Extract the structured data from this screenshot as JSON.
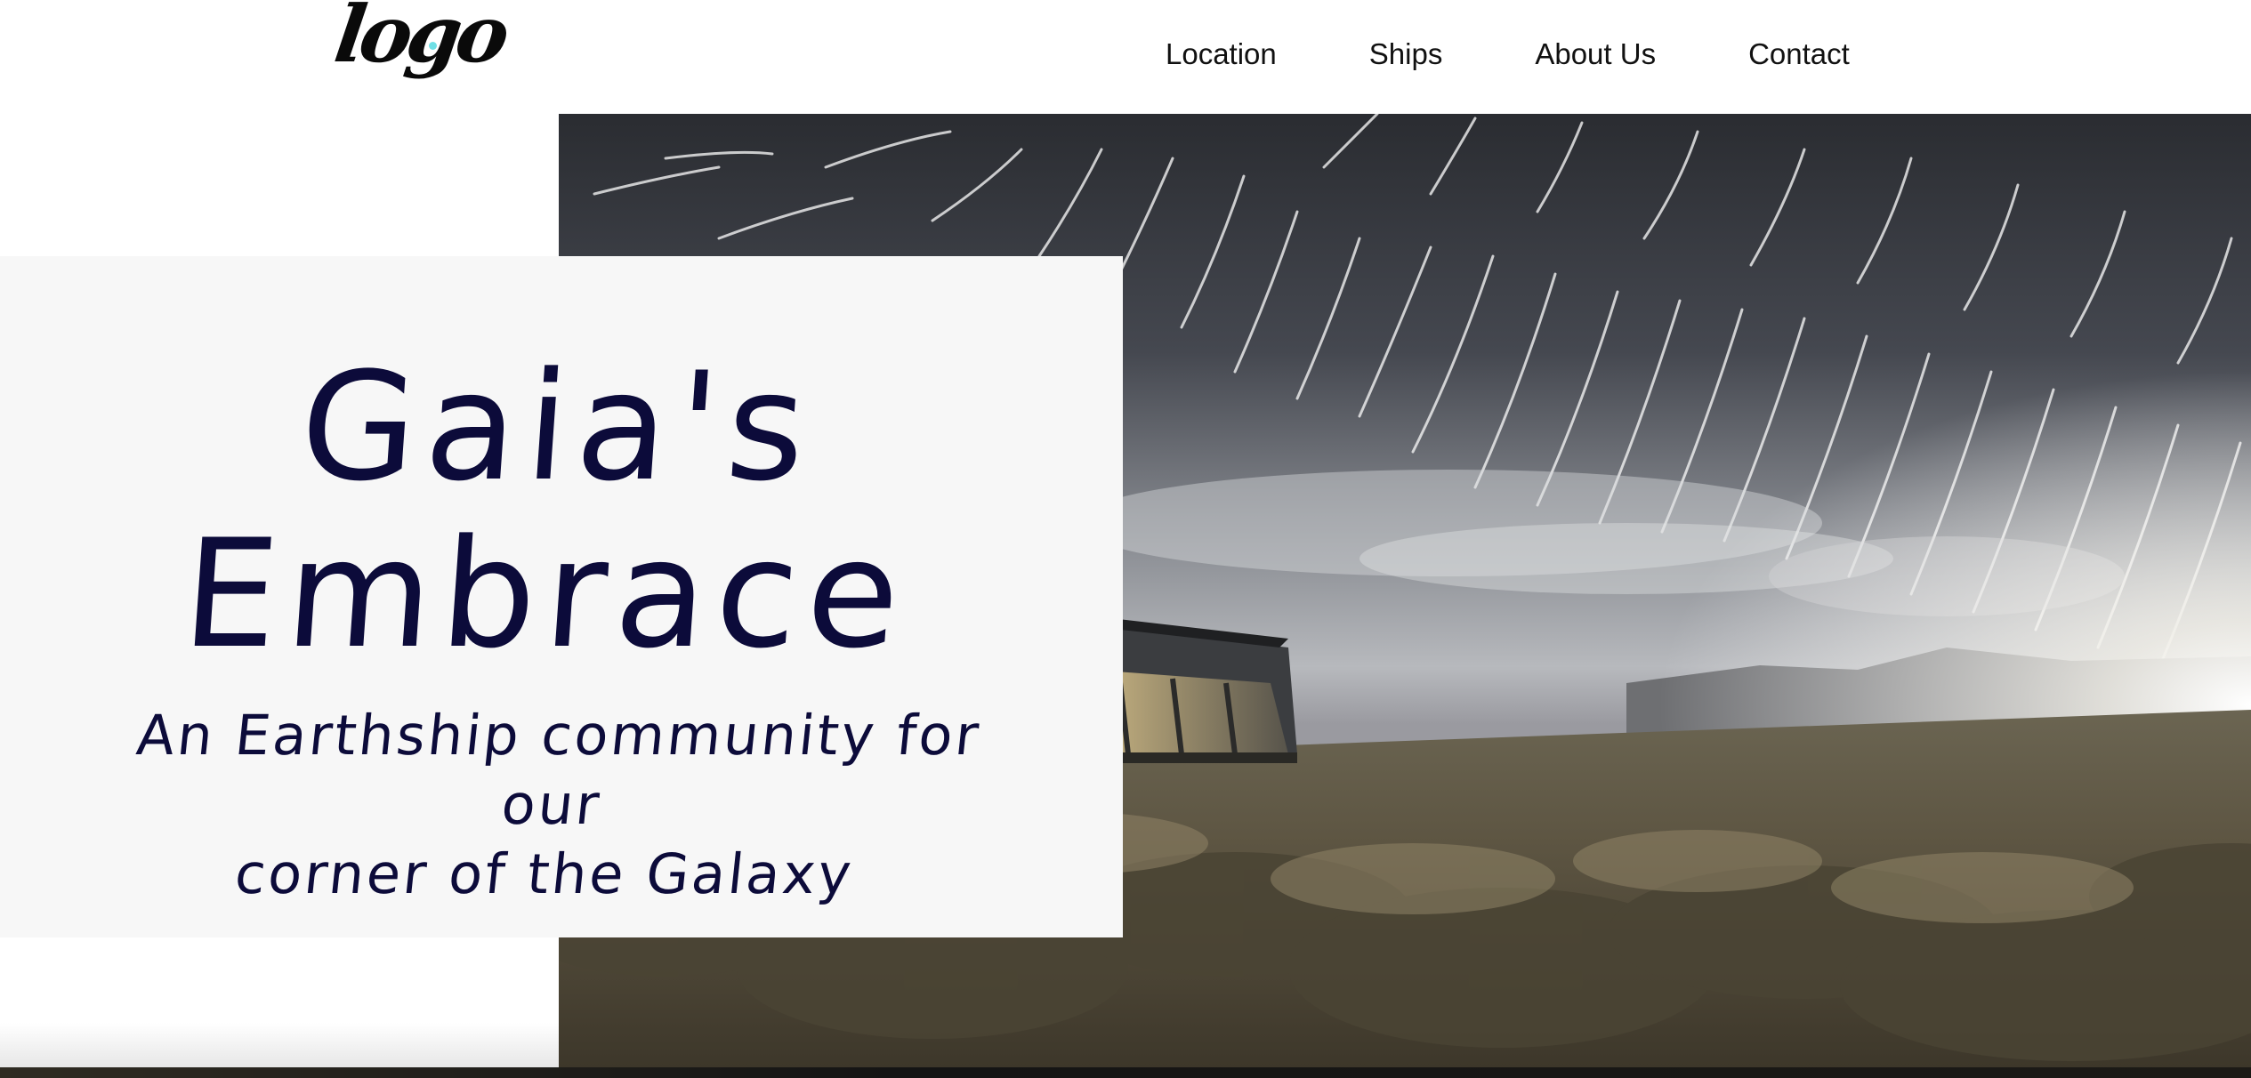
{
  "header": {
    "logo_text": "logo",
    "nav": [
      {
        "label": "Location"
      },
      {
        "label": "Ships"
      },
      {
        "label": "About Us"
      },
      {
        "label": "Contact"
      }
    ]
  },
  "hero": {
    "title_line1": "Gaia's",
    "title_line2": "Embrace",
    "subtitle_line1": "An Earthship community for our",
    "subtitle_line2": "corner of the Galaxy"
  },
  "colors": {
    "title": "#0c0b3a",
    "card_bg": "#f7f7f7",
    "logo_dot": "#6fe0e6"
  }
}
